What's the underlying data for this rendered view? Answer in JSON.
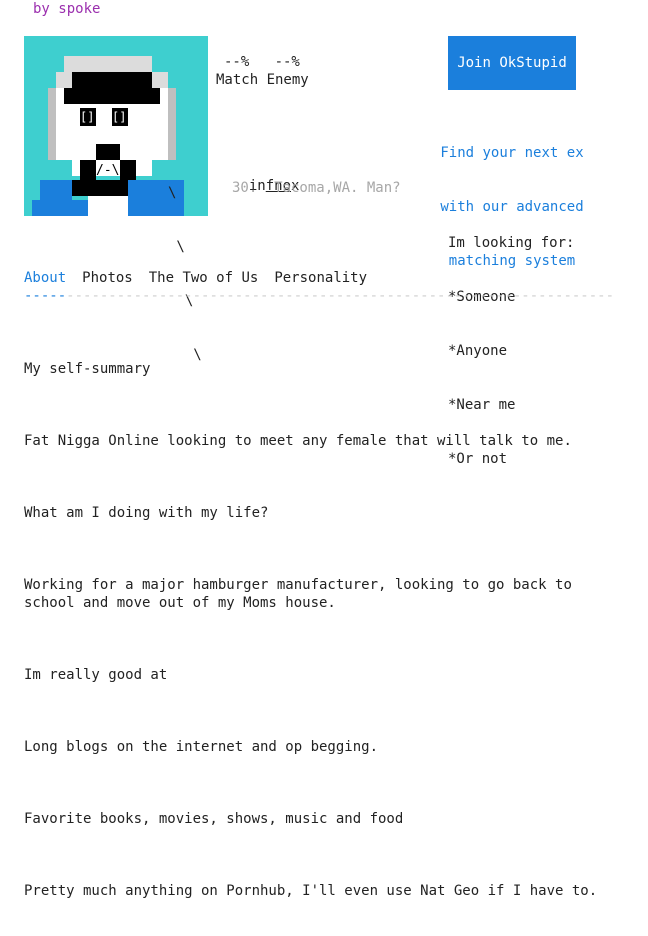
{
  "header": {
    "by_line": "by spoke"
  },
  "profile": {
    "percent_line": "--%   --%",
    "match_line": "Match Enemy",
    "username_pre": "in",
    "username_link": "fno",
    "username_post": "x",
    "meta": "30.  Tacoma,WA. Man?",
    "avatar_eye_left": "[]",
    "avatar_eye_right": "[]",
    "avatar_brows": "==   ==",
    "avatar_mouth": "/-\\",
    "slash_lines": [
      "\\",
      " \\",
      "  \\",
      "   \\"
    ]
  },
  "join_button": {
    "label": "Join OkStupid"
  },
  "promo": {
    "lines": [
      "Find your next ex",
      "with our advanced",
      "matching system"
    ]
  },
  "looking_for": {
    "heading": "Im looking for:",
    "items": [
      "*Someone",
      "*Anyone",
      "*Near me",
      "*Or not"
    ]
  },
  "tabs": [
    {
      "label": "About",
      "active": true
    },
    {
      "label": "Photos",
      "active": false
    },
    {
      "label": "The Two of Us",
      "active": false
    },
    {
      "label": "Personality",
      "active": false
    }
  ],
  "divider": {
    "active_part": "-----",
    "rest_part": "----------------------------------------------------------------------------------"
  },
  "about": {
    "paragraphs": [
      "My self-summary",
      "Fat Nigga Online looking to meet any female that will talk to me.",
      "What am I doing with my life?",
      "Working for a major hamburger manufacturer, looking to go back to\nschool and move out of my Moms house.",
      "Im really good at",
      "Long blogs on the internet and op begging.",
      "Favorite books, movies, shows, music and food",
      "Pretty much anything on Pornhub, I'll even use Nat Geo if I have to."
    ]
  },
  "colors": {
    "accent": "#1b7fdc",
    "avatar_bg": "#3ecfcf",
    "by_line": "#9b2fae",
    "muted": "#a7a7a7"
  }
}
